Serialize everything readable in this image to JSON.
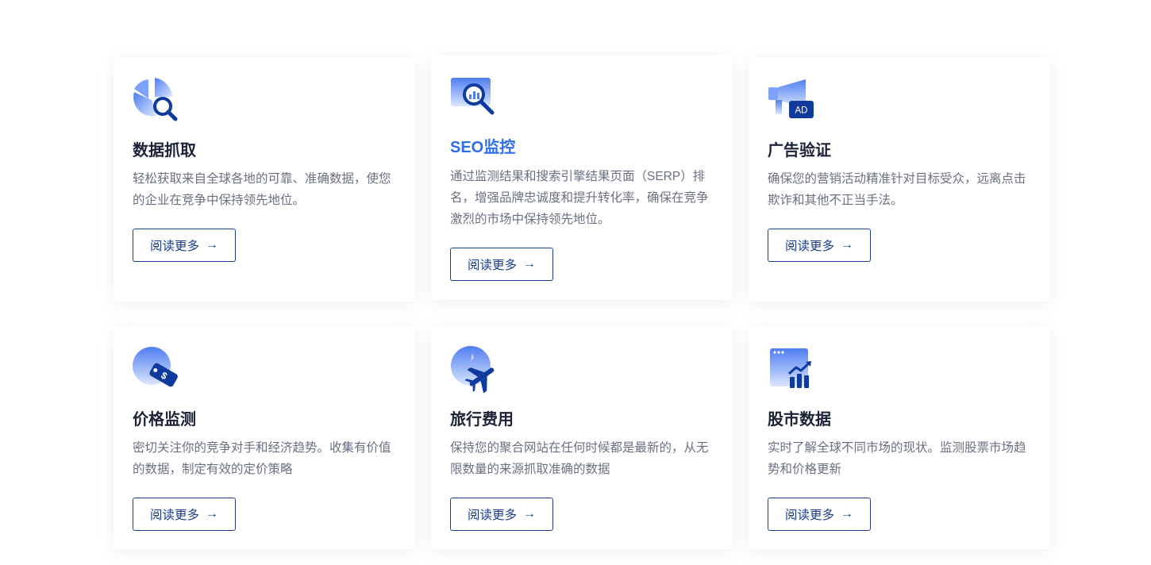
{
  "colors": {
    "title": "#1c2338",
    "title_active": "#2f6ee8",
    "text": "#6b7080",
    "button": "#1b3e8f",
    "icon_light": "#a9c2ff",
    "icon_mid": "#4f7ef0",
    "icon_dark": "#0f3a9e"
  },
  "cards": [
    {
      "title": "数据抓取",
      "icon": "pie-search-icon",
      "description": "轻松获取来自全球各地的可靠、准确数据，使您的企业在竞争中保持领先地位。",
      "button": "阅读更多",
      "button_icon": "arrow-right-icon"
    },
    {
      "title": "SEO监控",
      "icon": "monitor-magnifier-icon",
      "description": "通过监测结果和搜索引擎结果页面（SERP）排名，增强品牌忠诚度和提升转化率，确保在竞争激烈的市场中保持领先地位。",
      "button": "阅读更多",
      "button_icon": "arrow-right-icon",
      "highlighted": true
    },
    {
      "title": "广告验证",
      "icon": "megaphone-ad-icon",
      "badge": "AD",
      "description": "确保您的营销活动精准针对目标受众，远离点击欺诈和其他不正当手法。",
      "button": "阅读更多",
      "button_icon": "arrow-right-icon"
    },
    {
      "title": "价格监测",
      "icon": "price-tag-icon",
      "description": "密切关注你的竞争对手和经济趋势。收集有价值的数据，制定有效的定价策略",
      "button": "阅读更多",
      "button_icon": "arrow-right-icon"
    },
    {
      "title": "旅行费用",
      "icon": "airplane-icon",
      "description": "保持您的聚合网站在任何时候都是最新的，从无限数量的来源抓取准确的数据",
      "button": "阅读更多",
      "button_icon": "arrow-right-icon"
    },
    {
      "title": "股市数据",
      "icon": "stock-chart-icon",
      "description": "实时了解全球不同市场的现状。监测股票市场趋势和价格更新",
      "button": "阅读更多",
      "button_icon": "arrow-right-icon"
    }
  ]
}
